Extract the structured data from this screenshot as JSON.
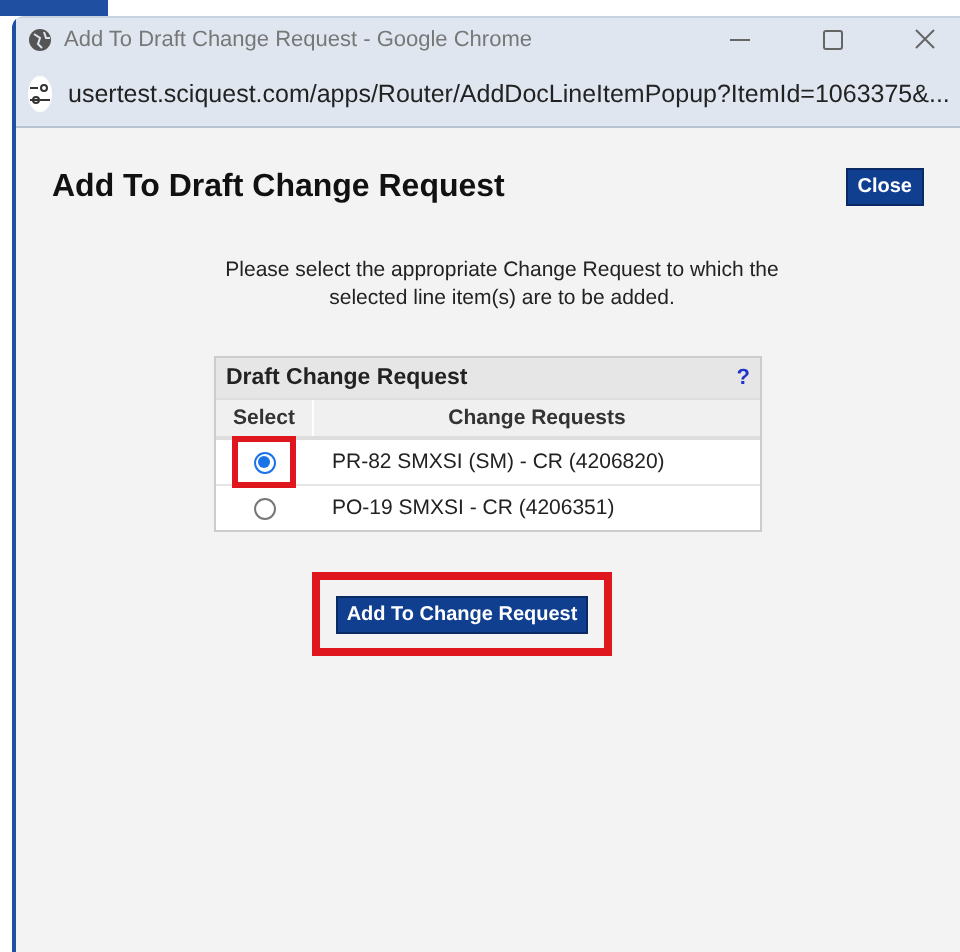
{
  "window": {
    "title": "Add To Draft Change Request - Google Chrome",
    "address": "usertest.sciquest.com/apps/Router/AddDocLineItemPopup?ItemId=1063375&..."
  },
  "page": {
    "heading": "Add To Draft Change Request",
    "close_button": "Close",
    "instructions": "Please select the appropriate Change Request to which the selected line item(s) are to be added."
  },
  "table": {
    "title": "Draft Change Request",
    "help": "?",
    "columns": [
      "Select",
      "Change Requests"
    ],
    "rows": [
      {
        "name": "PR-82 SMXSI (SM) - CR (4206820)",
        "selected": true,
        "highlighted": true
      },
      {
        "name": "PO-19 SMXSI - CR (4206351)",
        "selected": false,
        "highlighted": false
      }
    ]
  },
  "submit": {
    "label": "Add To Change Request",
    "highlighted": true
  }
}
